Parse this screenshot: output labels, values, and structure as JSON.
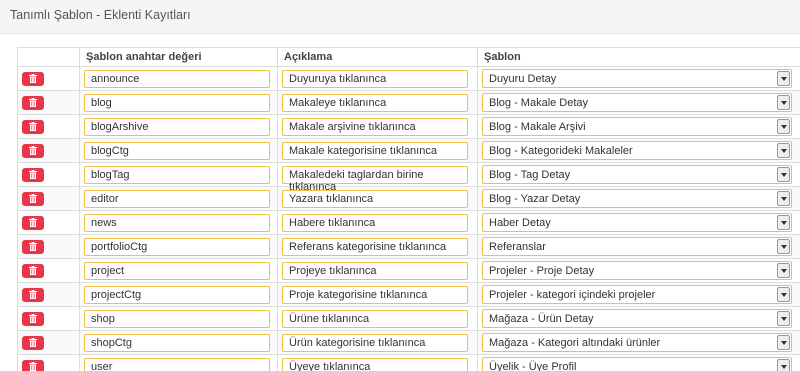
{
  "header": {
    "title": "Tanımlı Şablon - Eklenti Kayıtları"
  },
  "table": {
    "columns": [
      "",
      "Şablon anahtar değeri",
      "Açıklama",
      "Şablon"
    ],
    "rows": [
      {
        "key": "announce",
        "description": "Duyuruya tıklanınca",
        "template": "Duyuru Detay"
      },
      {
        "key": "blog",
        "description": "Makaleye tıklanınca",
        "template": "Blog - Makale Detay"
      },
      {
        "key": "blogArshive",
        "description": "Makale arşivine tıklanınca",
        "template": "Blog - Makale Arşivi"
      },
      {
        "key": "blogCtg",
        "description": "Makale kategorisine tıklanınca",
        "template": "Blog - Kategorideki Makaleler"
      },
      {
        "key": "blogTag",
        "description": "Makaledeki taglardan birine tıklanınca",
        "template": "Blog - Tag Detay"
      },
      {
        "key": "editor",
        "description": "Yazara tıklanınca",
        "template": "Blog - Yazar Detay"
      },
      {
        "key": "news",
        "description": "Habere tıklanınca",
        "template": "Haber Detay"
      },
      {
        "key": "portfolioCtg",
        "description": "Referans kategorisine tıklanınca",
        "template": "Referanslar"
      },
      {
        "key": "project",
        "description": "Projeye tıklanınca",
        "template": "Projeler - Proje Detay"
      },
      {
        "key": "projectCtg",
        "description": "Proje kategorisine tıklanınca",
        "template": "Projeler - kategori içindeki projeler"
      },
      {
        "key": "shop",
        "description": "Ürüne tıklanınca",
        "template": "Mağaza - Ürün Detay"
      },
      {
        "key": "shopCtg",
        "description": "Ürün kategorisine tıklanınca",
        "template": "Mağaza - Kategori altındaki ürünler"
      },
      {
        "key": "user",
        "description": "Üyeye tıklanınca",
        "template": "Üyelik - Üye Profil"
      }
    ]
  },
  "icons": {
    "delete": "trash-icon",
    "dropdown": "chevron-down-icon"
  },
  "colors": {
    "delete_button": "#e8354a",
    "field_border": "#f0c040"
  }
}
